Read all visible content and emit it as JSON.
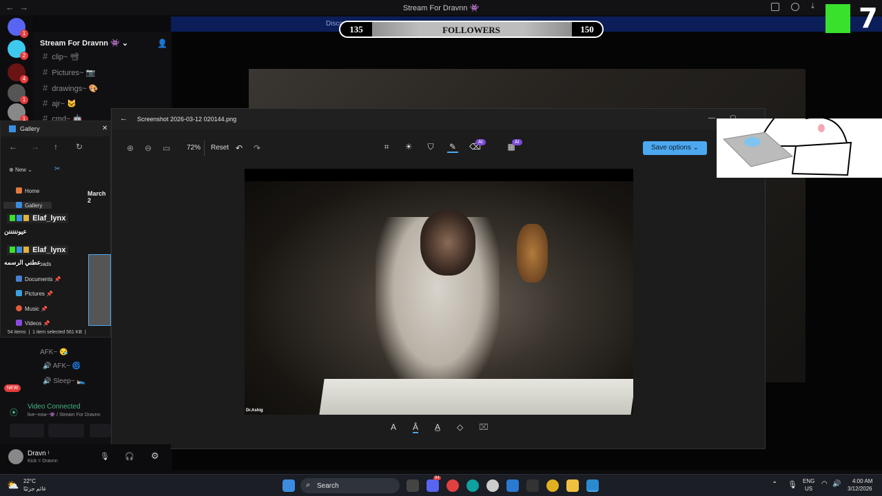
{
  "discord": {
    "window_title": "Stream For Dravnn 👾",
    "banner_text": "Disco",
    "server_name": "Stream For Dravnn 👾",
    "channels": [
      "clip~ 📽",
      "Pictures~ 📷",
      "drawings~ 🎨",
      "ajr~ 🐱",
      "cmd~ 🤖"
    ],
    "voice_channels": [
      "AFK~ 😪",
      "AFK~ 🌀",
      "Sleep~ 🛌"
    ],
    "new_badge": "NEW",
    "video_connected": "Video Connected",
    "video_sub": "live~now~👾 / Stream For Dravnn",
    "user_name": "Dravn ᵎ",
    "user_status": "Kick = Dravnn"
  },
  "overlay": {
    "followers_current": "135",
    "followers_label": "FOLLOWERS",
    "followers_goal": "150",
    "k7_digit": "7",
    "chat": [
      {
        "name": "Elaf_lynx",
        "message": "عيونننننن"
      },
      {
        "name": "Elaf_lynx",
        "message": "عطني الرسمه"
      }
    ]
  },
  "photos": {
    "file_name": "Screenshot 2026-03-12 020144.png",
    "zoom": "72%",
    "reset_label": "Reset",
    "ai_badge": "AI",
    "save_label": "Save options",
    "watermark": "Dr.Ashig"
  },
  "explorer": {
    "title": "Gallery",
    "new_label": "New",
    "nav_items": [
      "Home",
      "Gallery"
    ],
    "quick_items": [
      "Documents",
      "Pictures",
      "Music",
      "Videos"
    ],
    "partial_item": "oads",
    "date_header": "March 2",
    "status_count": "54 items",
    "status_selected": "1 item selected",
    "status_size": "561 KB"
  },
  "taskbar": {
    "weather_temp": "22°C",
    "weather_desc": "غائم جزئيًا",
    "search_placeholder": "Search",
    "lang": "ENG",
    "region": "US",
    "time": "4:00 AM",
    "date": "3/12/2026",
    "discord_badge": "94"
  },
  "badges": [
    "1",
    "2",
    "4",
    "1",
    "1"
  ]
}
